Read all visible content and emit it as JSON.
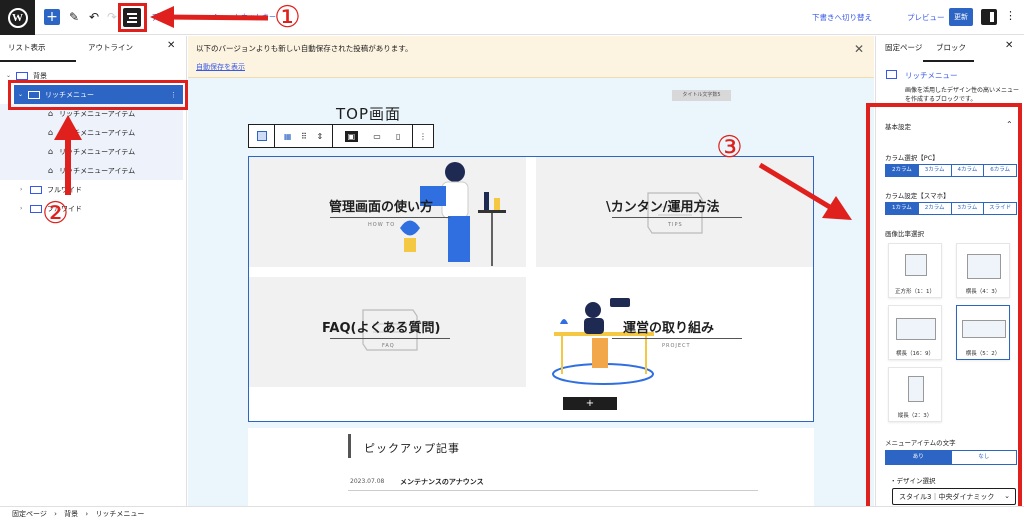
{
  "topbar": {
    "logo": "W",
    "add_icon": "plus-icon",
    "design_label": "デザ",
    "shortcut_label": "ショートカットキー",
    "draft_label": "下書きへ切り替え",
    "preview_label": "プレビュー",
    "update_label": "更新"
  },
  "left_panel": {
    "tab_list": "リスト表示",
    "tab_outline": "アウトライン",
    "close": "✕",
    "tree": [
      {
        "label": "背景",
        "level": 0
      },
      {
        "label": "リッチメニュー",
        "level": 1,
        "selected": true
      },
      {
        "label": "リッチメニューアイテム",
        "level": 2
      },
      {
        "label": "リッチメニューアイテム",
        "level": 2
      },
      {
        "label": "リッチメニューアイテム",
        "level": 2
      },
      {
        "label": "リッチメニューアイテム",
        "level": 2
      },
      {
        "label": "フルワイド",
        "level": 1
      },
      {
        "label": "フルワイド",
        "level": 1
      }
    ]
  },
  "notice": {
    "text": "以下のバージョンよりも新しい自動保存された投稿があります。",
    "link": "自動保存を表示",
    "close": "✕"
  },
  "editor": {
    "title_badge": "タイトル文字数5",
    "page_title": "TOP画面",
    "add_item": "+",
    "tiles": [
      {
        "title": "管理画面の使い方",
        "sub": "HOW TO"
      },
      {
        "title": "\\カンタン/運用方法",
        "sub": "TIPS"
      },
      {
        "title": "FAQ(よくある質問)",
        "sub": "FAQ"
      },
      {
        "title": "運営の取り組み",
        "sub": "PROJECT"
      }
    ],
    "pickup_title": "ピックアップ記事",
    "pickup_date": "2023.07.08",
    "pickup_post": "メンテナンスのアナウンス"
  },
  "right_panel": {
    "tab_page": "固定ページ",
    "tab_block": "ブロック",
    "close": "✕",
    "block_name": "リッチメニュー",
    "block_desc1": "画像を活用したデザイン性の高いメニュー",
    "block_desc2": "を作成するブロックです。",
    "section_title": "基本設定",
    "pc_label": "カラム選択【PC】",
    "pc_options": [
      "2カラム",
      "3カラム",
      "4カラム",
      "6カラム"
    ],
    "sp_label": "カラム設定【スマホ】",
    "sp_options": [
      "1カラム",
      "2カラム",
      "3カラム",
      "スライド"
    ],
    "ratio_label": "画像比率選択",
    "ratios": [
      "正方形（1：1）",
      "横長（4：3）",
      "横長（16：9）",
      "横長（5：2）",
      "縦長（2：3）"
    ],
    "text_label": "メニューアイテムの文字",
    "text_options": [
      "あり",
      "なし"
    ],
    "design_label": "・デザイン選択",
    "design_value": "スタイル3｜中央ダイナミック"
  },
  "breadcrumb": {
    "items": [
      "固定ページ",
      "背景",
      "リッチメニュー"
    ],
    "sep": "›"
  },
  "annotations": {
    "one": "①",
    "two": "②",
    "three": "③"
  },
  "colors": {
    "accent": "#2c65c4",
    "annotation": "#e0201c"
  }
}
